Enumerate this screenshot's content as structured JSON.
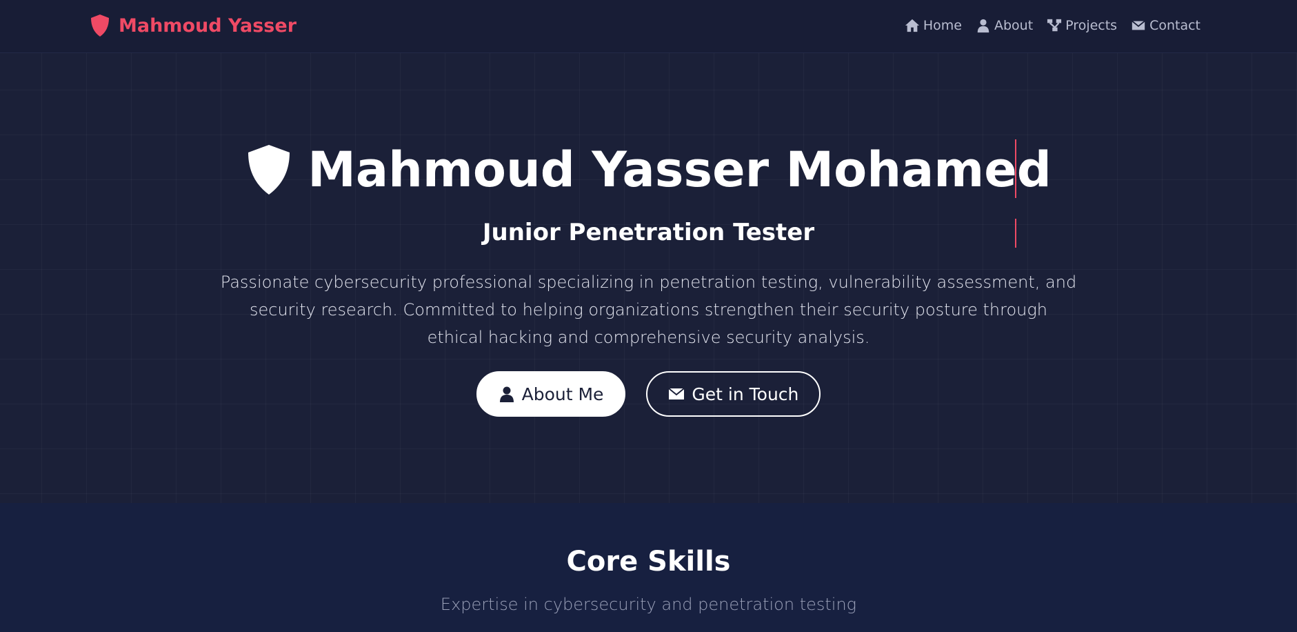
{
  "nav": {
    "brand": "Mahmoud Yasser",
    "brand_icon": "shield-icon",
    "links": [
      {
        "label": "Home",
        "icon": "home-icon"
      },
      {
        "label": "About",
        "icon": "user-icon"
      },
      {
        "label": "Projects",
        "icon": "sitemap-icon"
      },
      {
        "label": "Contact",
        "icon": "envelope-icon"
      }
    ]
  },
  "hero": {
    "title": "Mahmoud Yasser Mohamed",
    "title_icon": "shield-icon",
    "subtitle": "Junior Penetration Tester",
    "description_lines": [
      "Passionate cybersecurity professional specializing in penetration testing, vulnerability assessment, and",
      "security research. Committed to helping organizations strengthen their security posture through",
      "ethical hacking and comprehensive security analysis."
    ],
    "primary_button": "About Me",
    "secondary_button": "Get in Touch"
  },
  "skills": {
    "title": "Core Skills",
    "subtitle": "Expertise in cybersecurity and penetration testing"
  },
  "colors": {
    "accent": "#ef4a65",
    "background": "#1b2038",
    "section_bg": "#172040"
  }
}
